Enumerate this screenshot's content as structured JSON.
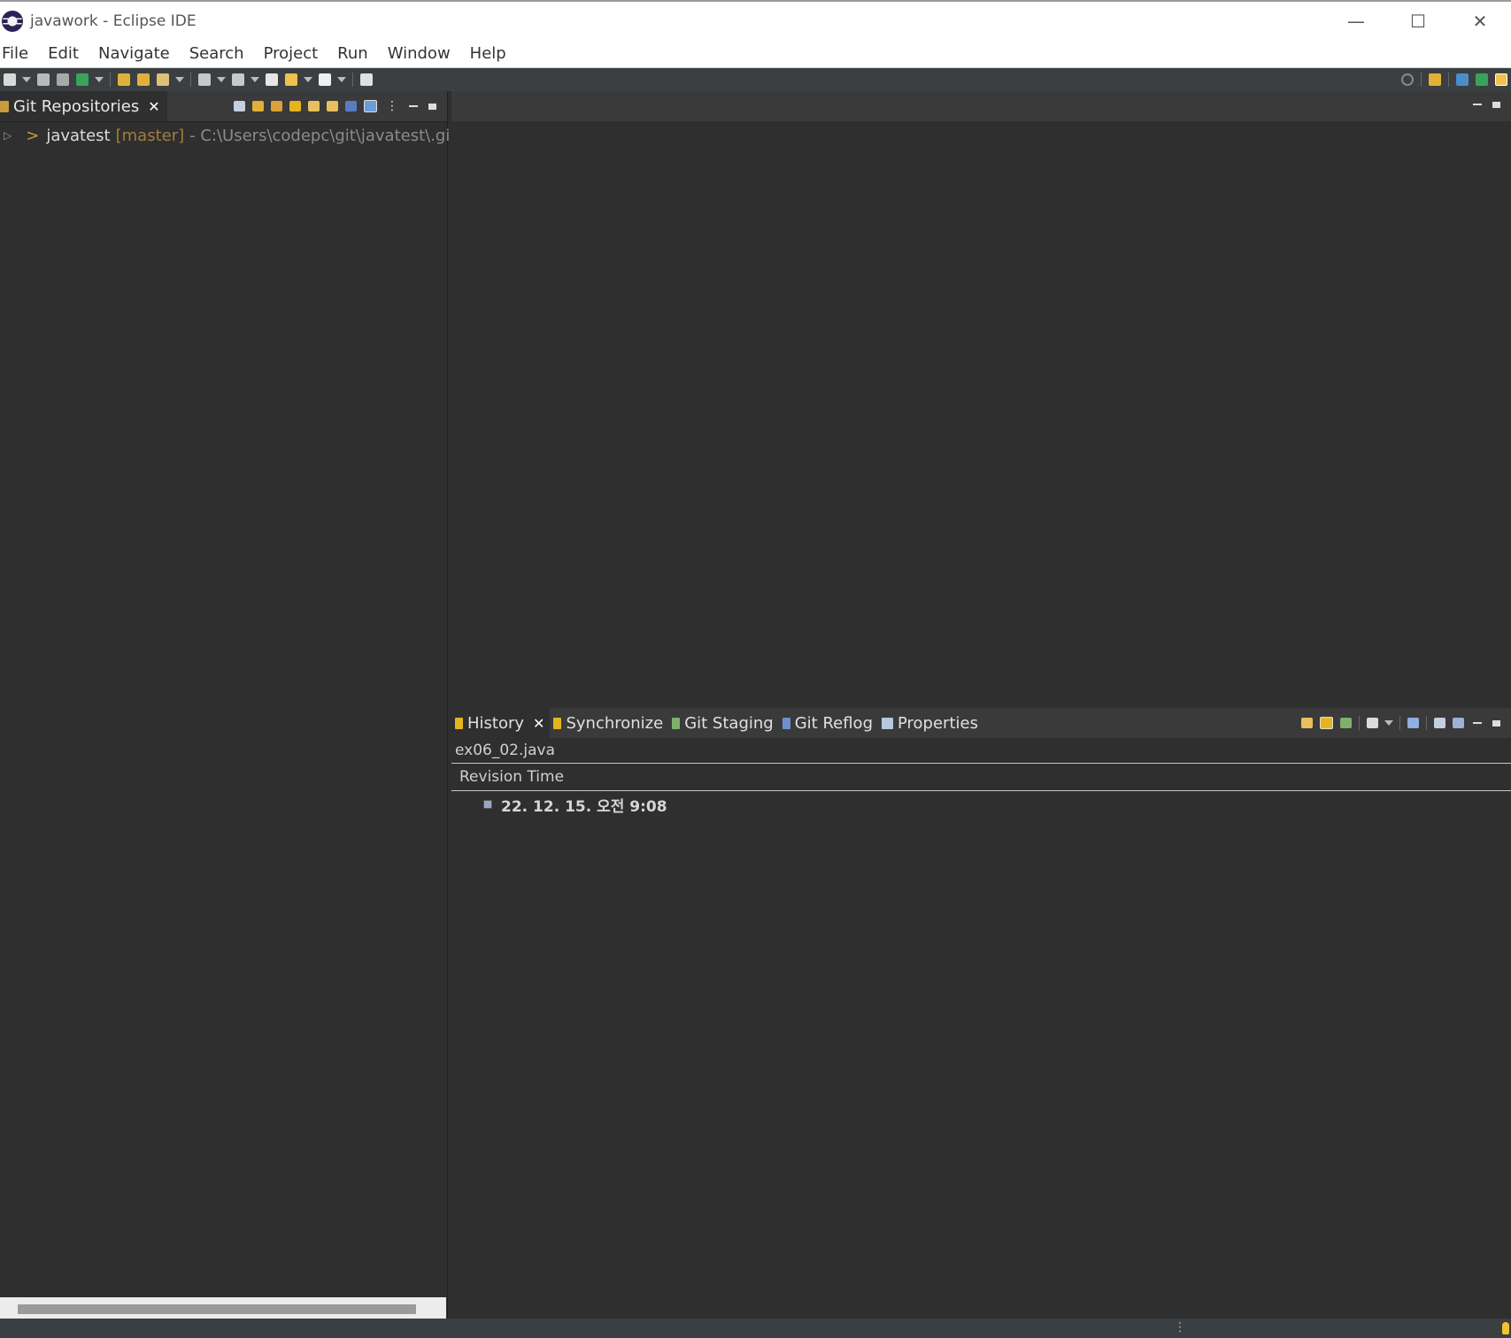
{
  "window": {
    "title": "javawork - Eclipse IDE",
    "controls": {
      "minimize": "—",
      "maximize": "☐",
      "close": "✕"
    }
  },
  "menu": {
    "items": [
      "File",
      "Edit",
      "Navigate",
      "Search",
      "Project",
      "Run",
      "Window",
      "Help"
    ]
  },
  "git_repositories": {
    "tab_label": "Git Repositories",
    "tab_close": "✕",
    "repo": {
      "marker": ">",
      "name": "javatest",
      "branch": "[master]",
      "path": "- C:\\Users\\codepc\\git\\javatest\\.gi"
    }
  },
  "bottom_panel": {
    "tabs": [
      {
        "label": "History",
        "active": true,
        "close": "✕"
      },
      {
        "label": "Synchronize",
        "active": false
      },
      {
        "label": "Git Staging",
        "active": false
      },
      {
        "label": "Git Reflog",
        "active": false
      },
      {
        "label": "Properties",
        "active": false
      }
    ],
    "file_name": "ex06_02.java",
    "column_header": "Revision Time",
    "revisions": [
      "22. 12. 15. 오전 9:08"
    ]
  },
  "colors": {
    "background": "#2f2f2f",
    "tab_bar": "#3a3a3a",
    "branch_text": "#a57c3d",
    "path_text": "#8b8b8b"
  }
}
